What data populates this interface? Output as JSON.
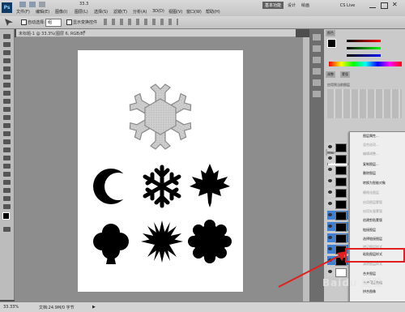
{
  "menubar": {
    "items": [
      "文件(F)",
      "编辑(E)",
      "图像(I)",
      "图层(L)",
      "选择(S)",
      "滤镜(T)",
      "分析(A)",
      "3D(D)",
      "视图(V)",
      "窗口(W)",
      "帮助(H)"
    ],
    "zoom": "33.3",
    "workspace": "基本功能",
    "design": "设计",
    "paint": "绘画",
    "cs_live": "CS Live"
  },
  "options": {
    "auto_select_label": "自动选择:",
    "auto_select_value": "组",
    "show_transform_label": "显示变换控件"
  },
  "document": {
    "tab_title": "未标题-1 @ 33.3%(图层 6, RGB/8)"
  },
  "status": {
    "zoom": "33.33%",
    "doc_info": "文档:24.9M/0 字节"
  },
  "panels": {
    "styles_title": "应用到当前图层",
    "normal": "正常",
    "buttons": [
      "调整",
      "蒙版"
    ]
  },
  "context_menu": {
    "items": [
      {
        "label": "图层属性...",
        "enabled": true
      },
      {
        "label": "混合选项...",
        "enabled": false
      },
      {
        "label": "编辑调整...",
        "enabled": false
      },
      {
        "label": "复制图层...",
        "enabled": true
      },
      {
        "label": "删除图层",
        "enabled": true
      },
      {
        "label": "转换为智能对象",
        "enabled": true
      },
      {
        "label": "栅格化图层",
        "enabled": false
      },
      {
        "label": "启用图层蒙版",
        "enabled": false
      },
      {
        "label": "启用矢量蒙版",
        "enabled": false
      },
      {
        "label": "创建剪贴蒙版",
        "enabled": true
      },
      {
        "label": "链接图层",
        "enabled": true
      },
      {
        "label": "选择链接图层",
        "enabled": true
      },
      {
        "label": "拷贝图层样式",
        "enabled": false
      },
      {
        "label": "粘贴图层样式",
        "enabled": true
      },
      {
        "label": "清除图层样式",
        "enabled": false
      },
      {
        "label": "合并图层",
        "enabled": true
      },
      {
        "label": "合并可见图层",
        "enabled": true
      },
      {
        "label": "拼合图像",
        "enabled": true
      }
    ],
    "highlighted": "粘贴图层样式"
  },
  "watermark": "Baidu 经验",
  "colors": {
    "accent_red": "#e02020",
    "highlight_blue": "#3f7fd4"
  }
}
